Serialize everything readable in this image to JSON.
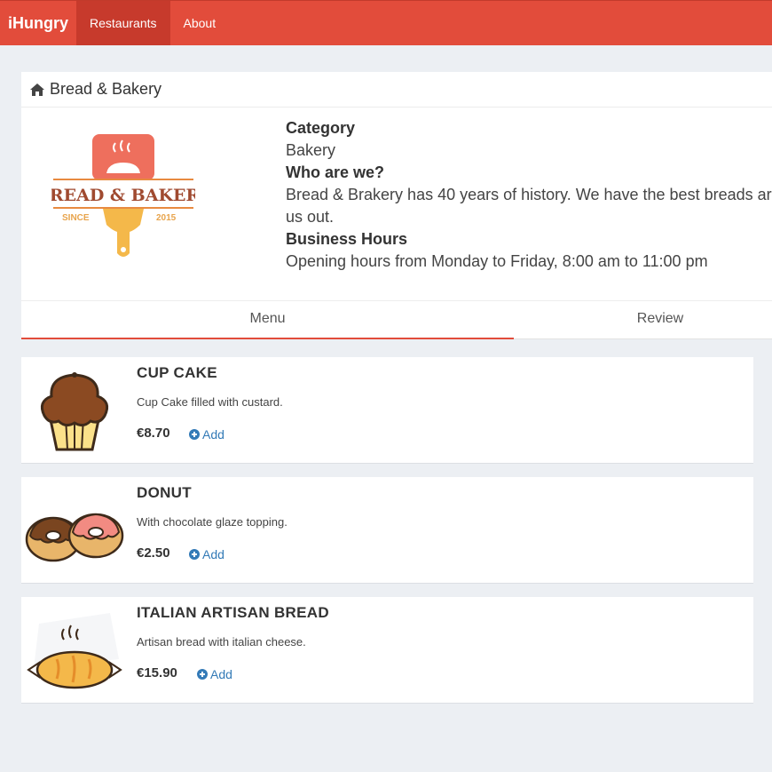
{
  "navbar": {
    "brand": "iHungry",
    "items": [
      {
        "label": "Restaurants",
        "active": true
      },
      {
        "label": "About",
        "active": false
      }
    ],
    "color": "#e24c3b"
  },
  "restaurant": {
    "title": "Bread & Bakery",
    "logo": {
      "line1": "BREAD & BAKERY",
      "since": "SINCE",
      "year": "2015"
    },
    "category_label": "Category",
    "category": "Bakery",
    "about_label": "Who are we?",
    "about_line1": "Bread & Brakery has 40 years of history. We have the best breads ar",
    "about_line2": "us out.",
    "hours_label": "Business Hours",
    "hours": "Opening hours from Monday to Friday, 8:00 am to 11:00 pm"
  },
  "tabs": [
    {
      "label": "Menu",
      "active": true
    },
    {
      "label": "Review",
      "active": false
    }
  ],
  "menu": [
    {
      "name": "CUP CAKE",
      "description": "Cup Cake filled with custard.",
      "price": "€8.70",
      "add_label": "Add"
    },
    {
      "name": "DONUT",
      "description": "With chocolate glaze topping.",
      "price": "€2.50",
      "add_label": "Add"
    },
    {
      "name": "ITALIAN ARTISAN BREAD",
      "description": "Artisan bread with italian cheese.",
      "price": "€15.90",
      "add_label": "Add"
    }
  ]
}
